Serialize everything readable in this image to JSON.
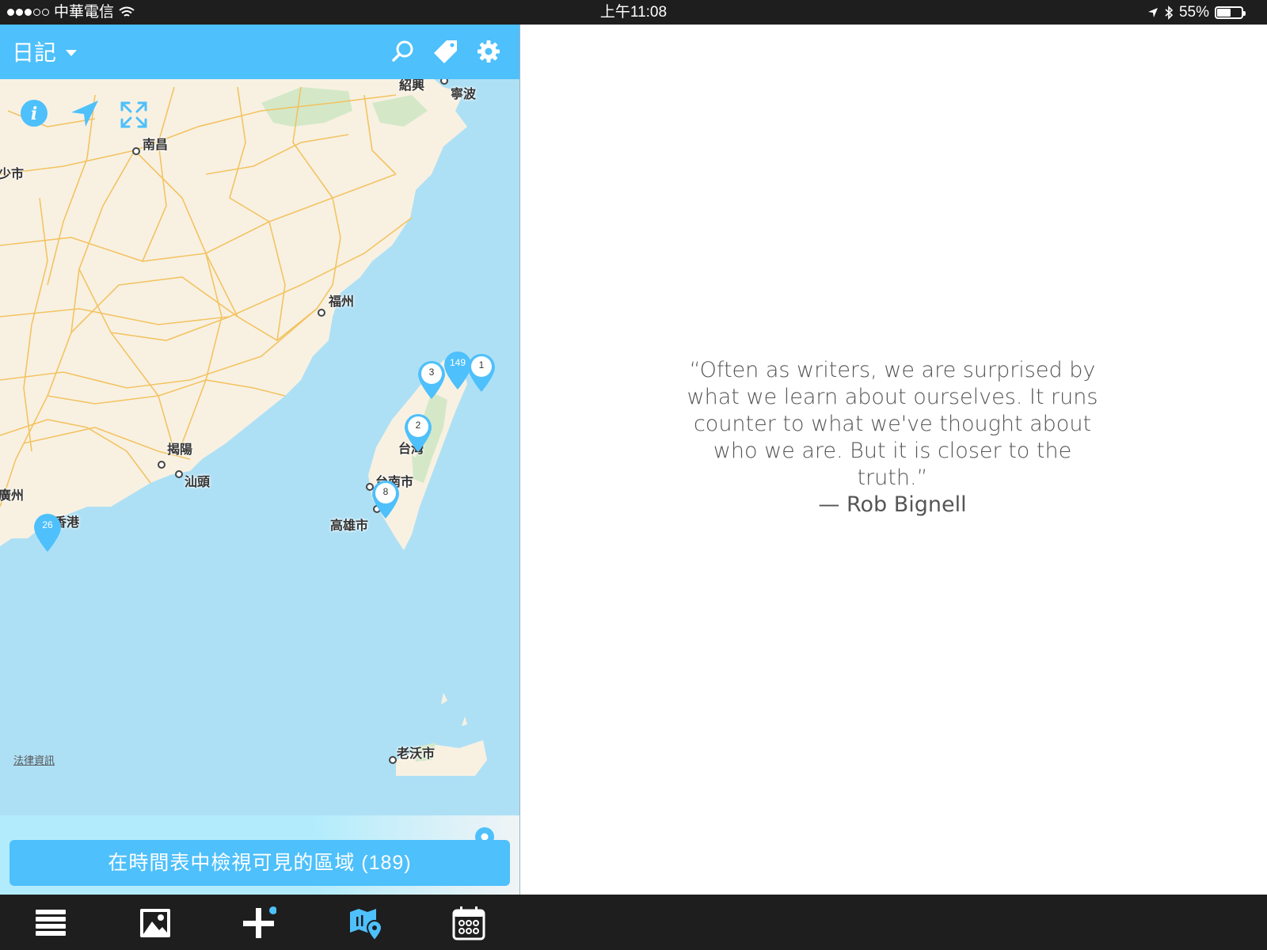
{
  "status_bar": {
    "carrier": "中華電信",
    "time": "上午11:08",
    "battery_percent": "55%",
    "battery_level": 0.55
  },
  "header": {
    "title": "日記",
    "icons": [
      "search-icon",
      "tag-icon",
      "gear-icon"
    ]
  },
  "map": {
    "legal_link": "法律資訊",
    "controls": [
      "info-icon",
      "location-arrow-icon",
      "expand-icon"
    ],
    "cities": {
      "shaoxing": "紹興",
      "ningbo": "寧波",
      "nanchang": "南昌",
      "changsha_partial": "少市",
      "fuzhou": "福州",
      "jieyang": "揭陽",
      "shantou": "汕頭",
      "guangzhou_partial": "廣州",
      "hongkong_partial": "香港",
      "taiwan": "台灣",
      "tainan": "台南市",
      "kaohsiung": "高雄市",
      "laoag": "老沃市"
    },
    "pins": {
      "taipei_big": "149",
      "keelung": "1",
      "hsinchu": "3",
      "taichung": "2",
      "tainan": "8",
      "hongkong": "26"
    }
  },
  "timeline_button": "在時間表中檢視可見的區域 (189)",
  "tab_bar": {
    "tabs": [
      "list-icon",
      "photo-icon",
      "add-entry-icon",
      "map-icon",
      "calendar-icon"
    ],
    "active": "map-icon"
  },
  "quote": {
    "text": "“Often as writers, we are surprised by what we learn about ourselves. It runs counter to what we've thought about who we are. But it is closer to the truth.”",
    "author": "— Rob Bignell"
  },
  "colors": {
    "accent": "#4ec0fb",
    "land": "#f8f1e2",
    "water": "#aee0f5",
    "roads": "#f3c15c",
    "bars": "#1e1e1e"
  }
}
